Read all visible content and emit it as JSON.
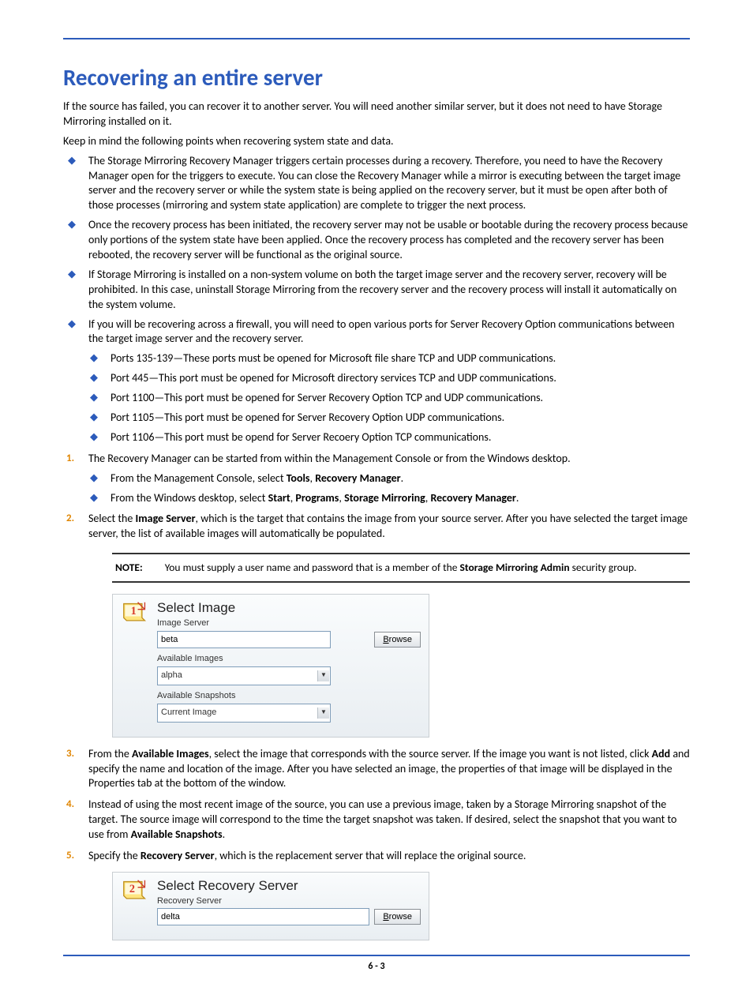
{
  "heading": "Recovering an entire server",
  "para_intro": "If the source has failed, you can recover it to another server. You will need another similar server, but it does not need to have Storage Mirroring installed on it.",
  "para_keep": "Keep in mind the following points when recovering system state and data.",
  "bullets": [
    "The Storage Mirroring Recovery Manager triggers certain processes during a recovery. Therefore, you need to have the Recovery Manager open for the triggers to execute. You can close the Recovery Manager while a mirror is executing between the target image server and the recovery server or while the system state is being applied on the recovery server, but it must be open after both of those processes (mirroring and system state application) are complete to trigger the next process.",
    "Once the recovery process has been initiated, the recovery server may not be usable or bootable during the recovery process because only portions of the system state have been applied. Once the recovery process has completed and the recovery server has been rebooted, the recovery server will be functional as the original source.",
    "If Storage Mirroring is installed on a non-system volume on both the target image server and the recovery server, recovery will be prohibited. In this case, uninstall Storage Mirroring from the recovery server and the recovery process will install it automatically on the system volume.",
    "If you will be recovering across a firewall, you will need to open various ports for Server Recovery Option communications between the target image server and the recovery server."
  ],
  "port_bullets": [
    "Ports 135-139—These ports must be opened for Microsoft file share TCP and UDP communications.",
    "Port 445—This port must be opened for Microsoft directory services TCP and UDP communications.",
    "Port 1100—This port must be opened for Server Recovery Option TCP and UDP communications.",
    "Port 1105—This port must be opened for Server Recovery Option UDP communications.",
    "Port 1106—This port must be opend for Server Recoery Option TCP communications."
  ],
  "step1_intro": "The Recovery Manager can be started from within the Management Console or from the Windows desktop.",
  "step1_sub": [
    {
      "pre": "From the Management Console, select ",
      "bold": [
        "Tools",
        "Recovery Manager"
      ]
    },
    {
      "pre": "From the Windows desktop, select ",
      "bold": [
        "Start",
        "Programs",
        "Storage Mirroring",
        "Recovery Manager"
      ]
    }
  ],
  "step2": {
    "pre": "Select the ",
    "b1": "Image Server",
    "post": ", which is the target that contains the image from your source server. After you have selected the target image server, the list of available images will automatically be populated."
  },
  "note": {
    "label": "NOTE:",
    "pre": "You must supply a user name and password that is a member of the ",
    "b": "Storage Mirroring Admin",
    "post": " security group."
  },
  "panel1": {
    "step_num": "1",
    "title": "Select Image",
    "image_server_label": "Image Server",
    "image_server_value": "beta",
    "browse": "Browse",
    "available_images_label": "Available Images",
    "available_images_value": "alpha",
    "available_snapshots_label": "Available Snapshots",
    "available_snapshots_value": "Current Image"
  },
  "step3": {
    "pre": "From the ",
    "b1": "Available Images",
    "mid": ", select the image that corresponds with the source server. If the image you want is not listed, click ",
    "b2": "Add",
    "post": " and specify the name and location of the image. After you have selected an image, the properties of that image will be displayed in the Properties tab at the bottom of the window."
  },
  "step4": {
    "pre": "Instead of using the most recent image of the source, you can use a previous image, taken by a Storage Mirroring snapshot of the target. The source image will correspond to the time the target snapshot was taken. If desired, select the snapshot that you want to use from ",
    "b1": "Available Snapshots",
    "post": "."
  },
  "step5": {
    "pre": "Specify the ",
    "b1": "Recovery Server",
    "post": ", which is the replacement server that will replace the original source."
  },
  "panel2": {
    "step_num": "2",
    "title": "Select Recovery Server",
    "recovery_server_label": "Recovery Server",
    "recovery_server_value": "delta",
    "browse": "Browse"
  },
  "page_number": "6 - 3"
}
